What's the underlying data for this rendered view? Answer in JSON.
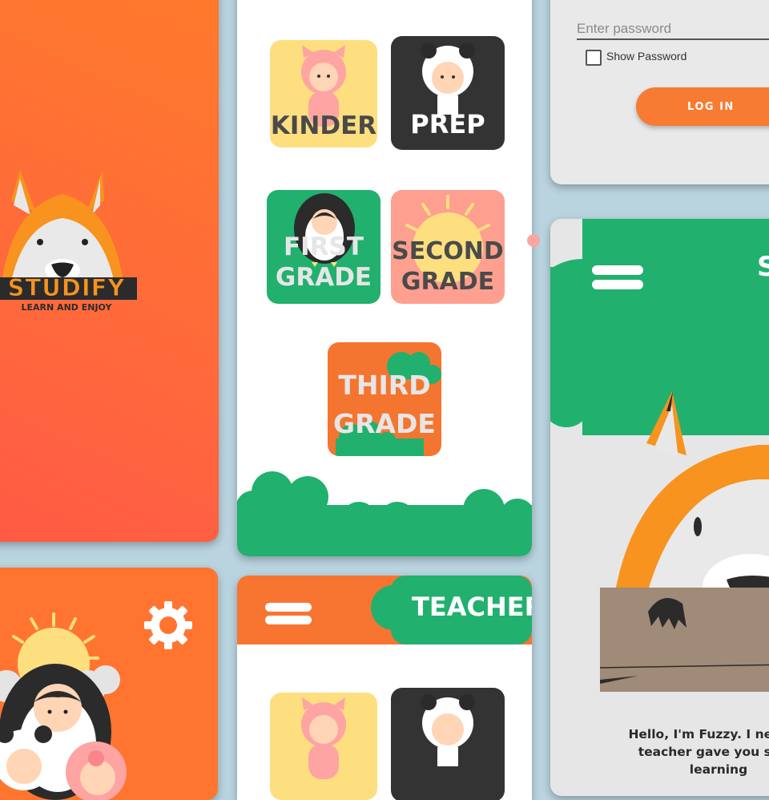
{
  "splash": {
    "brand": "STUDIFY",
    "tagline": "LEARN AND ENJOY"
  },
  "grades": {
    "tiles": [
      {
        "label_lines": [
          "KINDER"
        ],
        "bg": "#fddf80",
        "text_color": "#4a4a4a",
        "character": "pig-icon"
      },
      {
        "label_lines": [
          "PREP"
        ],
        "bg": "#333333",
        "text_color": "#ffffff",
        "character": "panda-icon"
      },
      {
        "label_lines": [
          "FIRST",
          "GRADE"
        ],
        "bg": "#21b06e",
        "text_color": "#e6e6e6",
        "character": "penguin-icon"
      },
      {
        "label_lines": [
          "SECOND",
          "GRADE"
        ],
        "bg": "#fe9f8f",
        "text_color": "#4a4a4a",
        "character": "sun-icon"
      },
      {
        "label_lines": [
          "THIRD",
          "GRADE"
        ],
        "bg": "#f47530",
        "text_color": "#e6e6e6",
        "character": "cloud-icon"
      }
    ]
  },
  "login": {
    "password_placeholder": "Enter password",
    "show_password_label": "Show Password",
    "login_button": "LOG IN"
  },
  "teacher_screen": {
    "title": "TEACHER",
    "menu_icon": "hamburger-menu-icon"
  },
  "intro_screen": {
    "header_partial": "S",
    "menu_icon": "hamburger-menu-icon",
    "message_lines": [
      "Hello, I'm Fuzzy. I need th",
      "teacher gave you so th",
      "learning"
    ]
  },
  "settings_screen": {
    "icon": "gear-icon"
  },
  "colors": {
    "orange": "#ff7530",
    "green": "#21b06e",
    "yellow": "#fddf80",
    "pink": "#fe9f8f",
    "dark": "#333333",
    "background": "#b9d3df"
  }
}
